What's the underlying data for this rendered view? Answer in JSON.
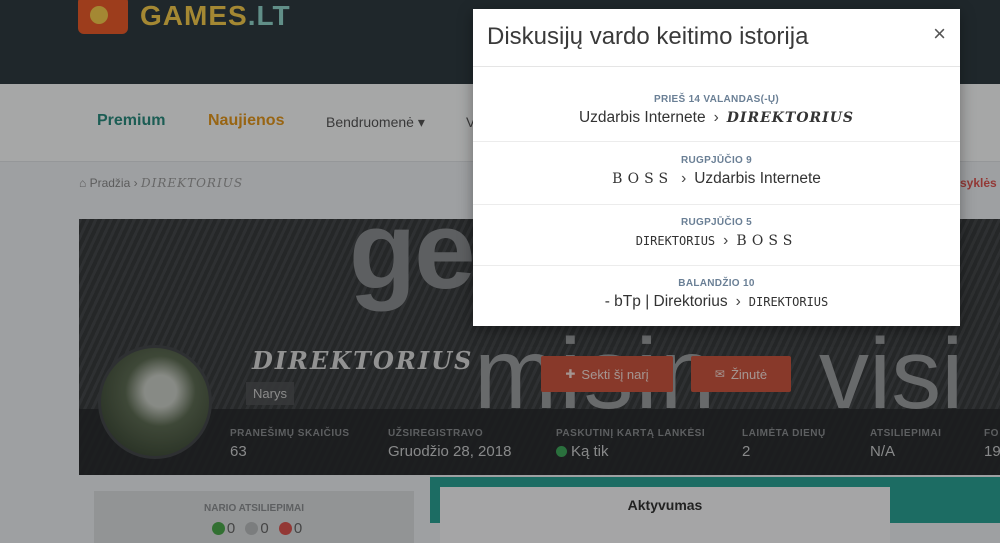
{
  "site": {
    "logo_text_a": "GAMES",
    "logo_text_b": ".LT"
  },
  "nav": {
    "premium": "Premium",
    "news": "Naujienos",
    "community": "Bendruomenė ▾",
    "more": "V"
  },
  "breadcrumb": {
    "home": "⌂ Pradžia",
    "sep": "›",
    "current": "DIREKTORIUS"
  },
  "right_link": "syklės",
  "cover": {
    "word1": "ge",
    "word2": "misin",
    "word3": "visi"
  },
  "profile": {
    "name": "DIREKTORIUS",
    "role": "Narys",
    "follow_label": "Sekti šį narį",
    "message_label": "Žinutė",
    "stats": [
      {
        "label": "PRANEŠIMŲ SKAIČIUS",
        "value": "63"
      },
      {
        "label": "UŽSIREGISTRAVO",
        "value": "Gruodžio 28, 2018"
      },
      {
        "label": "PASKUTINĮ KARTĄ LANKĖSI",
        "value": "Ką tik"
      },
      {
        "label": "LAIMĖTA DIENŲ",
        "value": "2"
      },
      {
        "label": "ATSILIEPIMAI",
        "value": "N/A"
      },
      {
        "label": "FO",
        "value": "19"
      }
    ]
  },
  "reputation": {
    "title": "NARIO ATSILIEPIMAI",
    "positive": "0",
    "neutral": "0",
    "negative": "0"
  },
  "tabs": {
    "active": "Aktyvumas"
  },
  "modal": {
    "title": "Diskusijų vardo keitimo istorija",
    "close": "×",
    "arrow": "›",
    "history": [
      {
        "date": "PRIEŠ 14 VALANDAS(-Ų)",
        "from": "Uzdarbis Internete",
        "to": "DIREKTORIUS"
      },
      {
        "date": "RUGPJŪČIO 9",
        "from": "BOSS",
        "to": "Uzdarbis Internete"
      },
      {
        "date": "RUGPJŪČIO 5",
        "from": "DIREKTORIUS",
        "to": "BOSS"
      },
      {
        "date": "BALANDŽIO 10",
        "from": "- bTp | Direktorius",
        "to": "DIREKTORIUS"
      }
    ]
  }
}
